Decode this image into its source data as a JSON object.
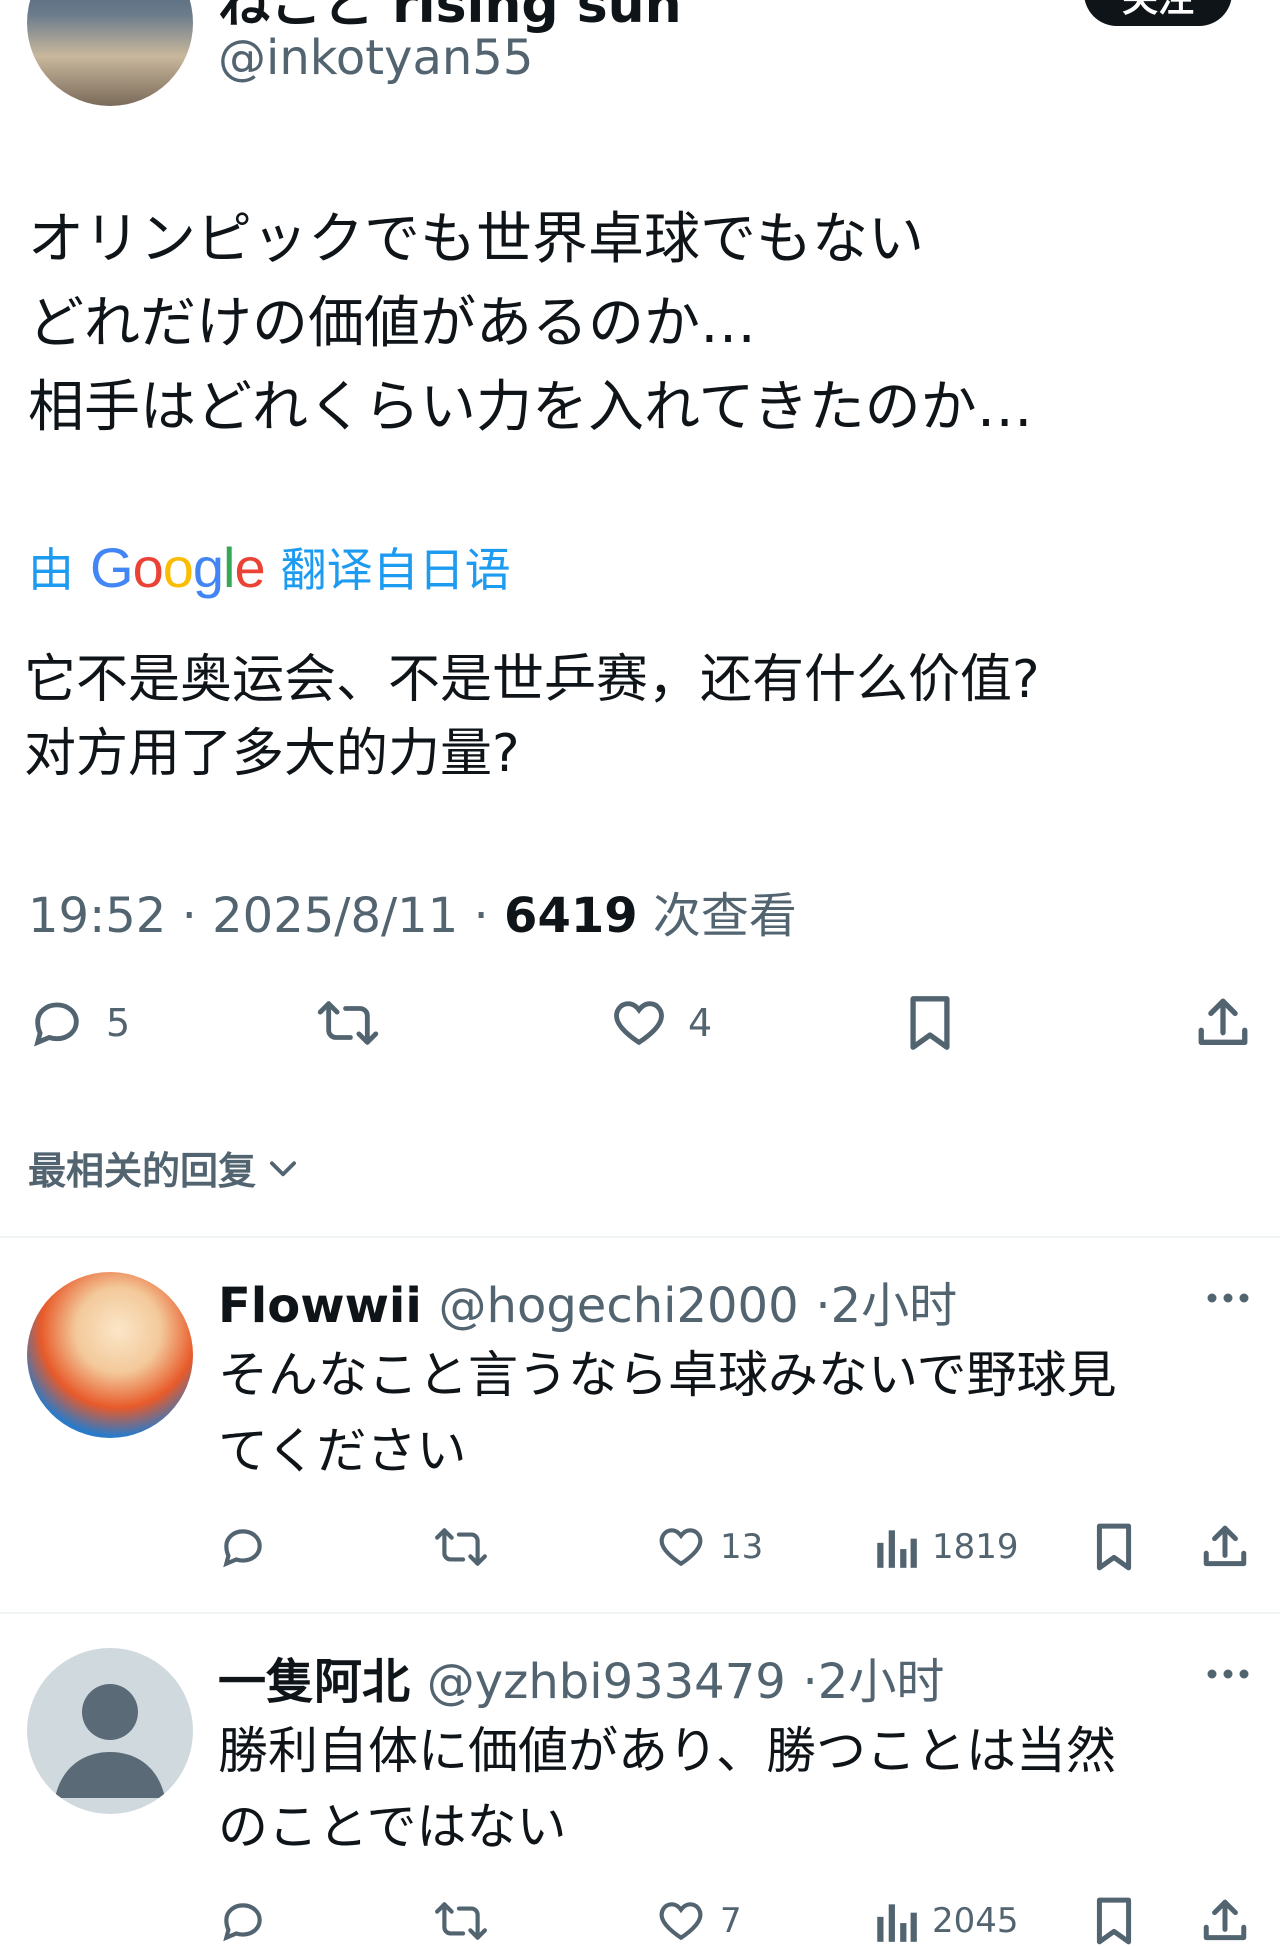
{
  "tweet": {
    "display_name": "ねこと rising sun",
    "handle": "@inkotyan55",
    "follow_label": "关注",
    "original_lines": [
      "オリンピックでも世界卓球でもない",
      "どれだけの価値があるのか…",
      "相手はどれくらい力を入れてきたのか…"
    ],
    "translate": {
      "prefix": "由",
      "brand": "Google",
      "suffix": "翻译自日语"
    },
    "translated_lines": [
      "它不是奥运会、不是世乒赛，还有什么价值?",
      "对方用了多大的力量?"
    ],
    "meta": {
      "time": "19:52",
      "date": "2025/8/11",
      "views": "6419",
      "views_label": "次查看",
      "separator": "·"
    },
    "actions": {
      "replies": "5",
      "likes": "4"
    }
  },
  "sort": {
    "label": "最相关的回复"
  },
  "replies": [
    {
      "name": "Flowwii",
      "handle": "@hogechi2000",
      "time": "·2小时",
      "lines": [
        "そんなこと言うなら卓球みないで野球見",
        "てください"
      ],
      "likes": "13",
      "views": "1819"
    },
    {
      "name": "一隻阿北",
      "handle": "@yzhbi933479",
      "time": "·2小时",
      "lines": [
        "勝利自体に価値があり、勝つことは当然",
        "のことではない"
      ],
      "likes": "7",
      "views": "2045"
    }
  ],
  "colors": {
    "text": "#0f1419",
    "muted": "#536471",
    "link": "#1d9bf0",
    "divider": "#eff3f4"
  },
  "icons": [
    "reply-icon",
    "retweet-icon",
    "like-icon",
    "bookmark-icon",
    "share-icon",
    "views-icon",
    "more-icon",
    "chevron-down-icon"
  ]
}
